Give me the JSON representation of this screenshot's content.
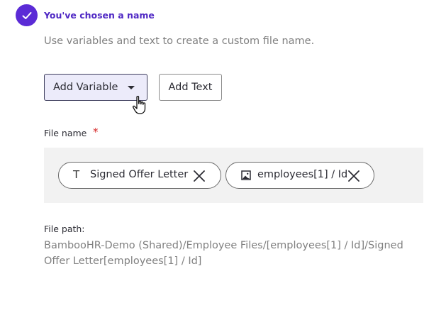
{
  "step": {
    "title": "You've chosen a name",
    "subtitle": "Use variables and text to create a custom file name."
  },
  "actions": {
    "add_variable_label": "Add Variable",
    "add_text_label": "Add Text"
  },
  "file_name": {
    "label": "File name",
    "required_marker": "*",
    "chips": [
      {
        "type": "text",
        "type_glyph": "T",
        "label": "Signed Offer Letter",
        "icon": "text-icon"
      },
      {
        "type": "variable",
        "label": "employees[1] / Id",
        "icon": "image-icon"
      }
    ]
  },
  "file_path": {
    "label": "File path:",
    "value": "BambooHR-Demo (Shared)/Employee Files/[employees[1] / Id]/Signed Offer Letter[employees[1] / Id]"
  },
  "colors": {
    "accent": "#5b2bd6",
    "accent_text": "#4f28c4",
    "required": "#d62828",
    "muted_text": "#808080"
  }
}
